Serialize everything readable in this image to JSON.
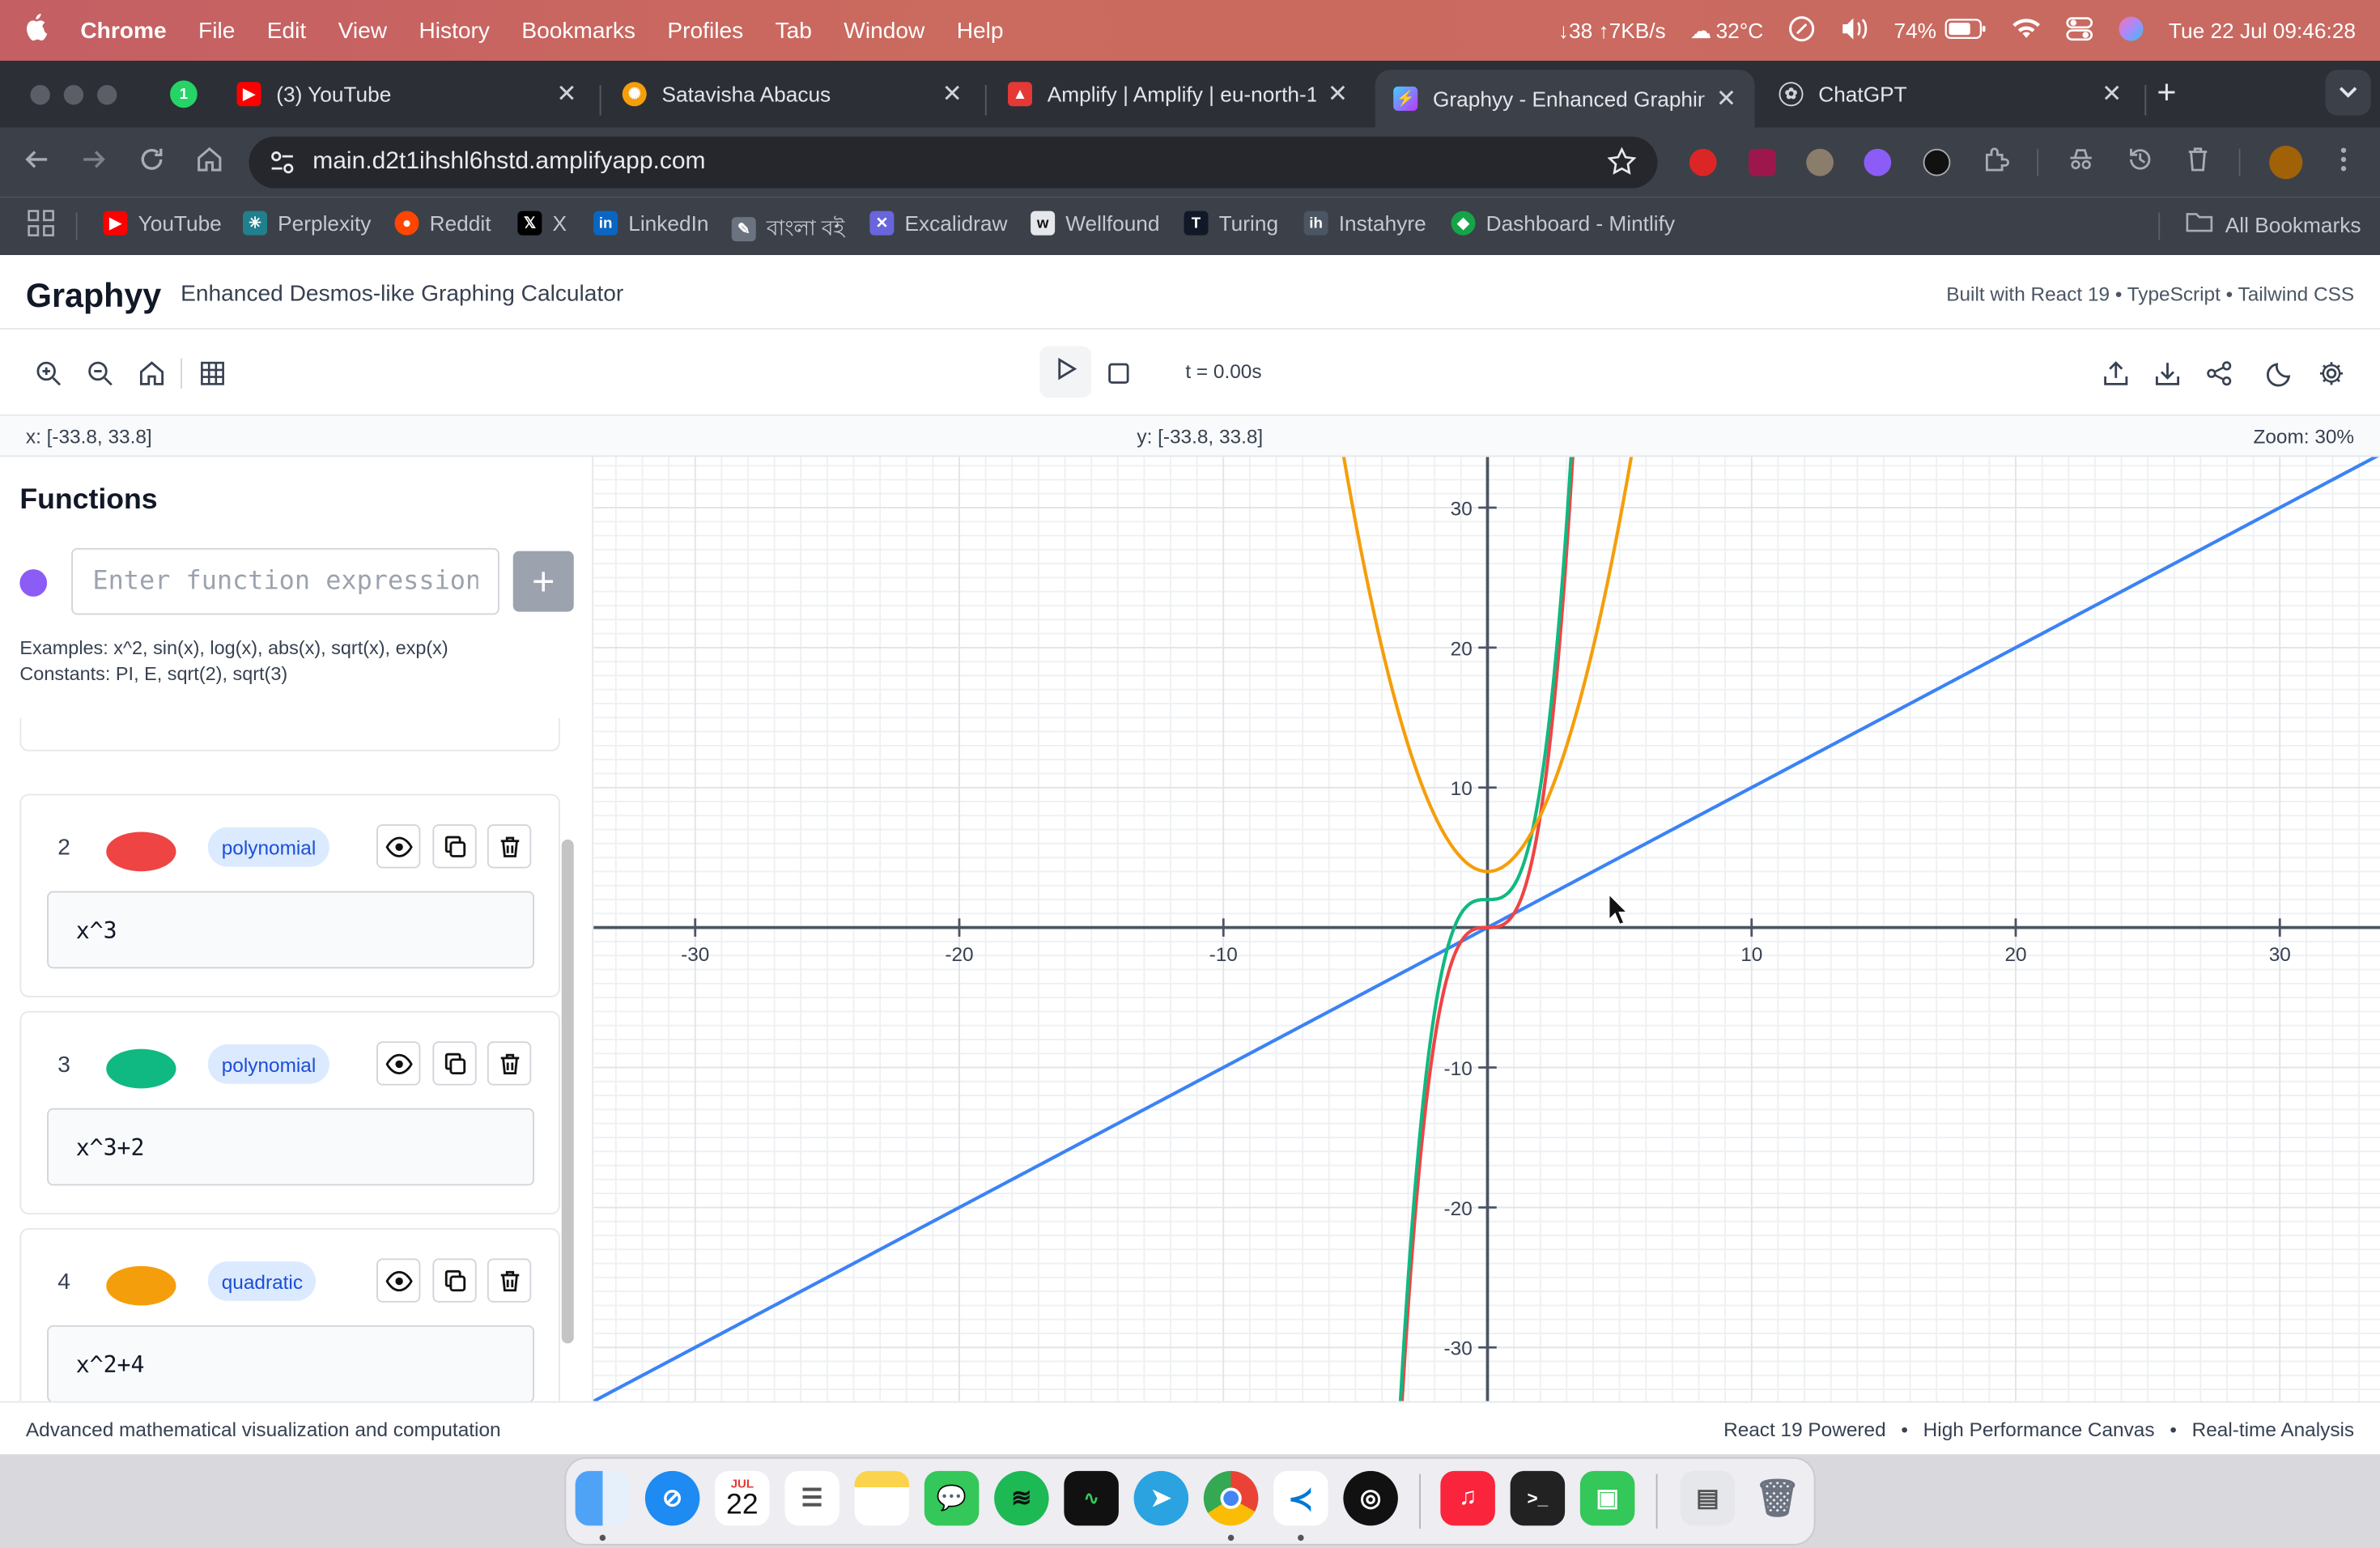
{
  "menubar": {
    "apple": "",
    "items": [
      "Chrome",
      "File",
      "Edit",
      "View",
      "History",
      "Bookmarks",
      "Profiles",
      "Tab",
      "Window",
      "Help"
    ],
    "network": "↓38 ↑7KB/s",
    "weather": "32°C",
    "battery": "74%",
    "datetime": "Tue 22 Jul  09:46:28"
  },
  "tabs": [
    {
      "title": "(3) YouTube",
      "icon": "youtube-icon",
      "color": "#ff0000"
    },
    {
      "title": "Satavisha Abacus",
      "icon": "gear-sun-icon",
      "color": "#f59e0b"
    },
    {
      "title": "Amplify | Amplify | eu-north-1",
      "icon": "amplify-icon",
      "color": "#e53935"
    },
    {
      "title": "Graphyy - Enhanced Graphing",
      "icon": "vite-icon",
      "color": "#a855f7"
    },
    {
      "title": "ChatGPT",
      "icon": "openai-icon",
      "color": "#d1d5db"
    }
  ],
  "whatsapp_badge": "1",
  "url": "main.d2t1ihshl6hstd.amplifyapp.com",
  "bookmarks": [
    {
      "label": "YouTube",
      "color": "#ff0000"
    },
    {
      "label": "Perplexity",
      "color": "#20808d"
    },
    {
      "label": "Reddit",
      "color": "#ff4500"
    },
    {
      "label": "X",
      "color": "#000000"
    },
    {
      "label": "LinkedIn",
      "color": "#0a66c2"
    },
    {
      "label": "বাংলা বই",
      "color": "#6b7280"
    },
    {
      "label": "Excalidraw",
      "color": "#6965db"
    },
    {
      "label": "Wellfound",
      "color": "#e5e7eb"
    },
    {
      "label": "Turing",
      "color": "#111827"
    },
    {
      "label": "Instahyre",
      "color": "#4b5563"
    },
    {
      "label": "Dashboard - Mintlify",
      "color": "#16a34a"
    }
  ],
  "all_bookmarks": "All Bookmarks",
  "app": {
    "title": "Graphyy",
    "subtitle": "Enhanced Desmos-like Graphing Calculator",
    "built": "Built with React 19 • TypeScript • Tailwind CSS",
    "time": "t = 0.00s",
    "x_range": "x: [-33.8, 33.8]",
    "y_range": "y: [-33.8, 33.8]",
    "zoom": "Zoom: 30%",
    "functions_title": "Functions",
    "input_placeholder": "Enter function expression",
    "add_label": "+",
    "examples": "Examples: x^2, sin(x), log(x), abs(x), sqrt(x), exp(x)",
    "constants": "Constants: PI, E, sqrt(2), sqrt(3)",
    "new_color": "#8b5cf6"
  },
  "functions": [
    {
      "index": "2",
      "color": "#ef4444",
      "type": "polynomial",
      "expr": "x^3"
    },
    {
      "index": "3",
      "color": "#10b981",
      "type": "polynomial",
      "expr": "x^3+2"
    },
    {
      "index": "4",
      "color": "#f59e0b",
      "type": "quadratic",
      "expr": "x^2+4"
    }
  ],
  "hidden_line_color": "#3b82f6",
  "footer": {
    "left": "Advanced mathematical visualization and computation",
    "r1": "React 19 Powered",
    "r2": "High Performance Canvas",
    "r3": "Real-time Analysis"
  },
  "dock_date": {
    "month": "JUL",
    "day": "22"
  },
  "chart_data": {
    "type": "line",
    "xlim": [
      -33.8,
      33.8
    ],
    "ylim": [
      -33.8,
      33.8
    ],
    "x_ticks": [
      -30,
      -20,
      -10,
      10,
      20,
      30
    ],
    "y_ticks": [
      30,
      20,
      10,
      -10,
      -20,
      -30
    ],
    "grid": true,
    "series": [
      {
        "expr": "x",
        "color": "#3b82f6"
      },
      {
        "expr": "x^3",
        "color": "#ef4444"
      },
      {
        "expr": "x^3+2",
        "color": "#10b981"
      },
      {
        "expr": "x^2+4",
        "color": "#f59e0b"
      }
    ]
  }
}
